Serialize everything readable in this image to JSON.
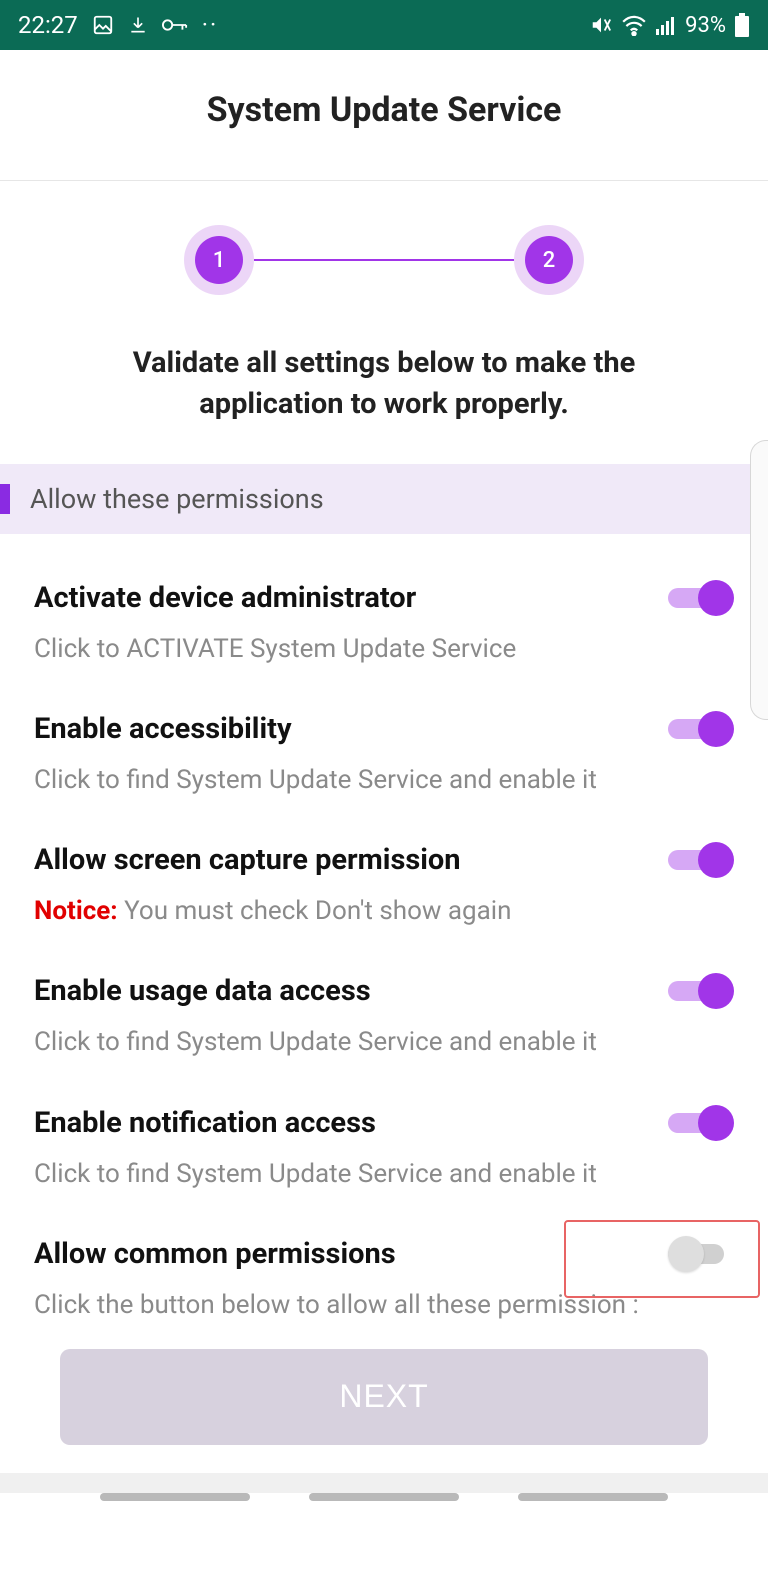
{
  "statusbar": {
    "time": "22:27",
    "battery_text": "93%"
  },
  "page": {
    "title": "System Update Service",
    "instruction": "Validate all settings below to make the application to work properly.",
    "section_header": "Allow these permissions",
    "stepper": {
      "step1": "1",
      "step2": "2"
    }
  },
  "permissions": [
    {
      "title": "Activate device administrator",
      "subtitle": "Click to ACTIVATE System Update Service",
      "on": true
    },
    {
      "title": "Enable accessibility",
      "subtitle": "Click to find System Update Service and enable it",
      "on": true
    },
    {
      "title": "Allow screen capture permission",
      "notice_prefix": "Notice:",
      "notice_rest": " You must check Don't show again",
      "on": true
    },
    {
      "title": "Enable usage data access",
      "subtitle": "Click to find System Update Service and enable it",
      "on": true
    },
    {
      "title": "Enable notification access",
      "subtitle": "Click to find System Update Service and enable it",
      "on": true
    },
    {
      "title": "Allow common permissions",
      "subtitle": "Click the button below to allow all these permission :",
      "on": false,
      "highlighted": true
    }
  ],
  "next_button": "NEXT"
}
